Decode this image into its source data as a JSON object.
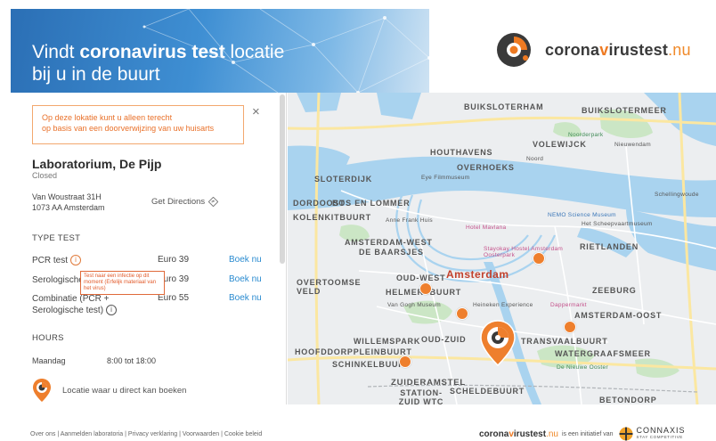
{
  "banner": {
    "title_prefix": "Vindt ",
    "title_bold": "coronavirus test",
    "title_suffix": " locatie",
    "title_line2": "bij u in de buurt"
  },
  "logo": {
    "text_a": "corona",
    "text_v": "v",
    "text_b": "irus",
    "text_c": "test",
    "text_d": ".nu"
  },
  "notice": {
    "line1": "Op deze lokatie kunt u alleen terecht",
    "line2": "op basis van een doorverwijzing van uw huisarts"
  },
  "close_label": "×",
  "location": {
    "name": "Laboratorium, De Pijp",
    "status": "Closed",
    "address_line1": "Van Woustraat 31H",
    "address_line2": "1073 AA Amsterdam",
    "directions": "Get Directions"
  },
  "type_test": {
    "heading": "TYPE TEST",
    "rows": [
      {
        "name": "PCR test",
        "price": "Euro 39",
        "book": "Boek nu"
      },
      {
        "name": "Serologische",
        "price": "Euro 39",
        "book": "Boek nu"
      },
      {
        "name_line1": "Combinatie (PCR +",
        "name_line2": "Serologische test)",
        "price": "Euro 55",
        "book": "Boek nu"
      }
    ],
    "tooltip": "Test naar een infectie op dit moment (Erfelijk materiaal van het virus)"
  },
  "hours": {
    "heading": "HOURS",
    "day": "Maandag",
    "time": "8:00 tot 18:00"
  },
  "legend": {
    "label": "Locatie waar u direct kan boeken"
  },
  "map": {
    "labels": {
      "buiksloterham": "BUIKSLOTERHAM",
      "buiksloterhmeer": "BUIKSLOTERMEER",
      "noorderpark": "Noorderpark",
      "volewijck": "VOLEWIJCK",
      "nieuwendam": "Nieuwendam",
      "houthavens": "HOUTHAVENS",
      "noord": "Noord",
      "overhoeks": "OVERHOEKS",
      "sloterdijk": "SLOTERDIJK",
      "eye": "Eye Filmmuseum",
      "schellingwoude": "Schellingwoude",
      "bosenlommer": "BOS EN LOMMER",
      "dorddost": "DORDOOST",
      "kolenkit": "KOLENKITBUURT",
      "annefrank": "Anne Frank Huis",
      "nemo": "NEMO Science Museum",
      "maritiem": "Het Scheepvaartmuseum",
      "mavlana": "Hotel Mavlana",
      "amsterdamwest": "AMSTERDAM-WEST",
      "baarsjes": "DE BAARSJES",
      "rietlanden": "RIETLANDEN",
      "stayokay": "Stayokay Hostel Amsterdam Oosterpark",
      "amsterdam": "Amsterdam",
      "oudwest": "OUD-WEST",
      "overtoomse": "OVERTOOMSE VELD",
      "helmers": "HELMERSBUURT",
      "zeeburg": "ZEEBURG",
      "vangogh": "Van Gogh Museum",
      "heineken": "Heineken Experience",
      "dappermarkt": "Dappermarkt",
      "amsterdamoost": "AMSTERDAM-OOST",
      "willemspark": "WILLEMSPARK",
      "oudzuid": "OUD-ZUID",
      "transvaal": "TRANSVAALBUURT",
      "hoofddorp": "HOOFDDORPPLEINBUURT",
      "watergraafsmeer": "WATERGRAAFSMEER",
      "schinkel": "SCHINKELBUURT",
      "nieuweooster": "De Nieuwe Ooster",
      "zuideramstel": "ZUIDERAMSTEL",
      "stationzuid": "STATION-ZUID WTC",
      "scheldebuurt": "SCHELDEBUURT",
      "betondorp": "BETONDORP",
      "a10": "A10",
      "s100": "S100",
      "s116": "S116",
      "s118": "S118",
      "s112": "S112",
      "s113": "S113",
      "s102": "S102",
      "s103": "S103",
      "s106": "S106"
    }
  },
  "footer": {
    "links": [
      "Over ons",
      "Aanmelden laboratoria",
      "Privacy verklaring",
      "Voorwaarden",
      "Cookie beleid"
    ],
    "separator": " | ",
    "brand_a": "corona",
    "brand_v": "v",
    "brand_b": "irus",
    "brand_c": "test",
    "brand_d": ".nu",
    "initiative": "is een initiatief van",
    "connaxis": "CONNAXIS",
    "connaxis_sub": "STAY COMPETITIVE"
  },
  "colors": {
    "accent": "#ee7f2d",
    "link": "#2a8bd0",
    "banner": "#3f8fd3"
  }
}
